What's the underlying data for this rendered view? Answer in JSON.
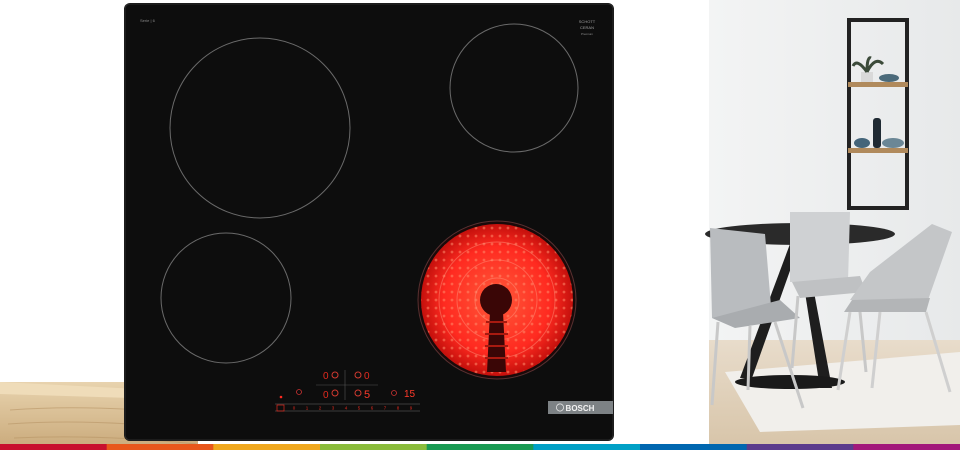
{
  "cooktop": {
    "brand": "BOSCH",
    "model_label": "Serie | 6",
    "badge_line1": "SCHOTT",
    "badge_line2": "CERAN",
    "badge_line3": "Premium",
    "zone_hot_label": "Active cooking zone",
    "display_top": "0 0",
    "display_mid": "0 5",
    "timer_value": "15",
    "slider_numbers": [
      "0",
      "1",
      "2",
      "3",
      "4",
      "5",
      "6",
      "7",
      "8",
      "9"
    ],
    "accent_red": "#ff2a20"
  },
  "footer_bar_colors": [
    "#c8102e",
    "#e8571c",
    "#f0a81e",
    "#8bbd3c",
    "#1a9b54",
    "#00a0c6",
    "#0067b0",
    "#5b3b8c",
    "#a2187a"
  ]
}
